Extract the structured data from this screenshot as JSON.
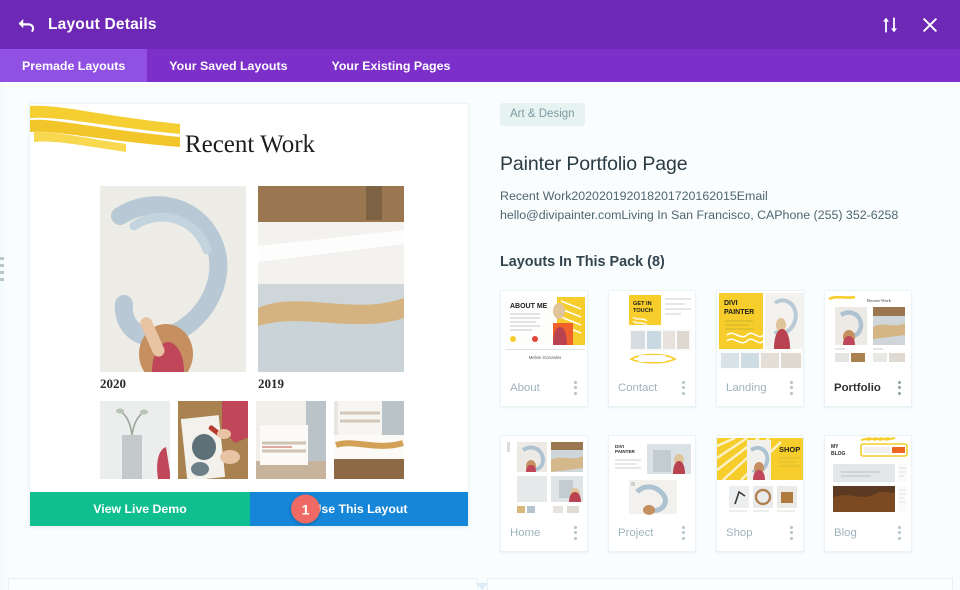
{
  "header": {
    "title": "Layout Details",
    "back_icon": "back-arrow-icon",
    "sort_icon": "sort-updown-icon",
    "close_icon": "close-icon"
  },
  "tabs": [
    {
      "label": "Premade Layouts",
      "active": true
    },
    {
      "label": "Your Saved Layouts",
      "active": false
    },
    {
      "label": "Your Existing Pages",
      "active": false
    }
  ],
  "preview": {
    "heading": "Recent Work",
    "years": [
      "2020",
      "2019"
    ],
    "buttons": {
      "demo": "View Live Demo",
      "use": "Use This Layout"
    },
    "step_badge": "1"
  },
  "detail": {
    "category": "Art & Design",
    "title": "Painter Portfolio Page",
    "description": "Recent Work202020192018201720162015Email hello@divipainter.comLiving In San Francisco, CAPhone (255) 352-6258",
    "pack_heading": "Layouts In This Pack (8)",
    "layouts": [
      {
        "label": "About",
        "active": false
      },
      {
        "label": "Contact",
        "active": false
      },
      {
        "label": "Landing",
        "active": false
      },
      {
        "label": "Portfolio",
        "active": true
      },
      {
        "label": "Home",
        "active": false
      },
      {
        "label": "Project",
        "active": false
      },
      {
        "label": "Shop",
        "active": false
      },
      {
        "label": "Blog",
        "active": false
      }
    ]
  },
  "colors": {
    "titlebar": "#6d28b5",
    "tabbar": "#7c30c9",
    "tab_active": "#9050e4",
    "demo_button": "#0fbf8f",
    "use_button": "#1586d8",
    "step_badge": "#ef6a64",
    "category_badge_bg": "#e7f3f1",
    "page_bg": "#f9fdfd",
    "accent_yellow": "#f5ce32"
  }
}
